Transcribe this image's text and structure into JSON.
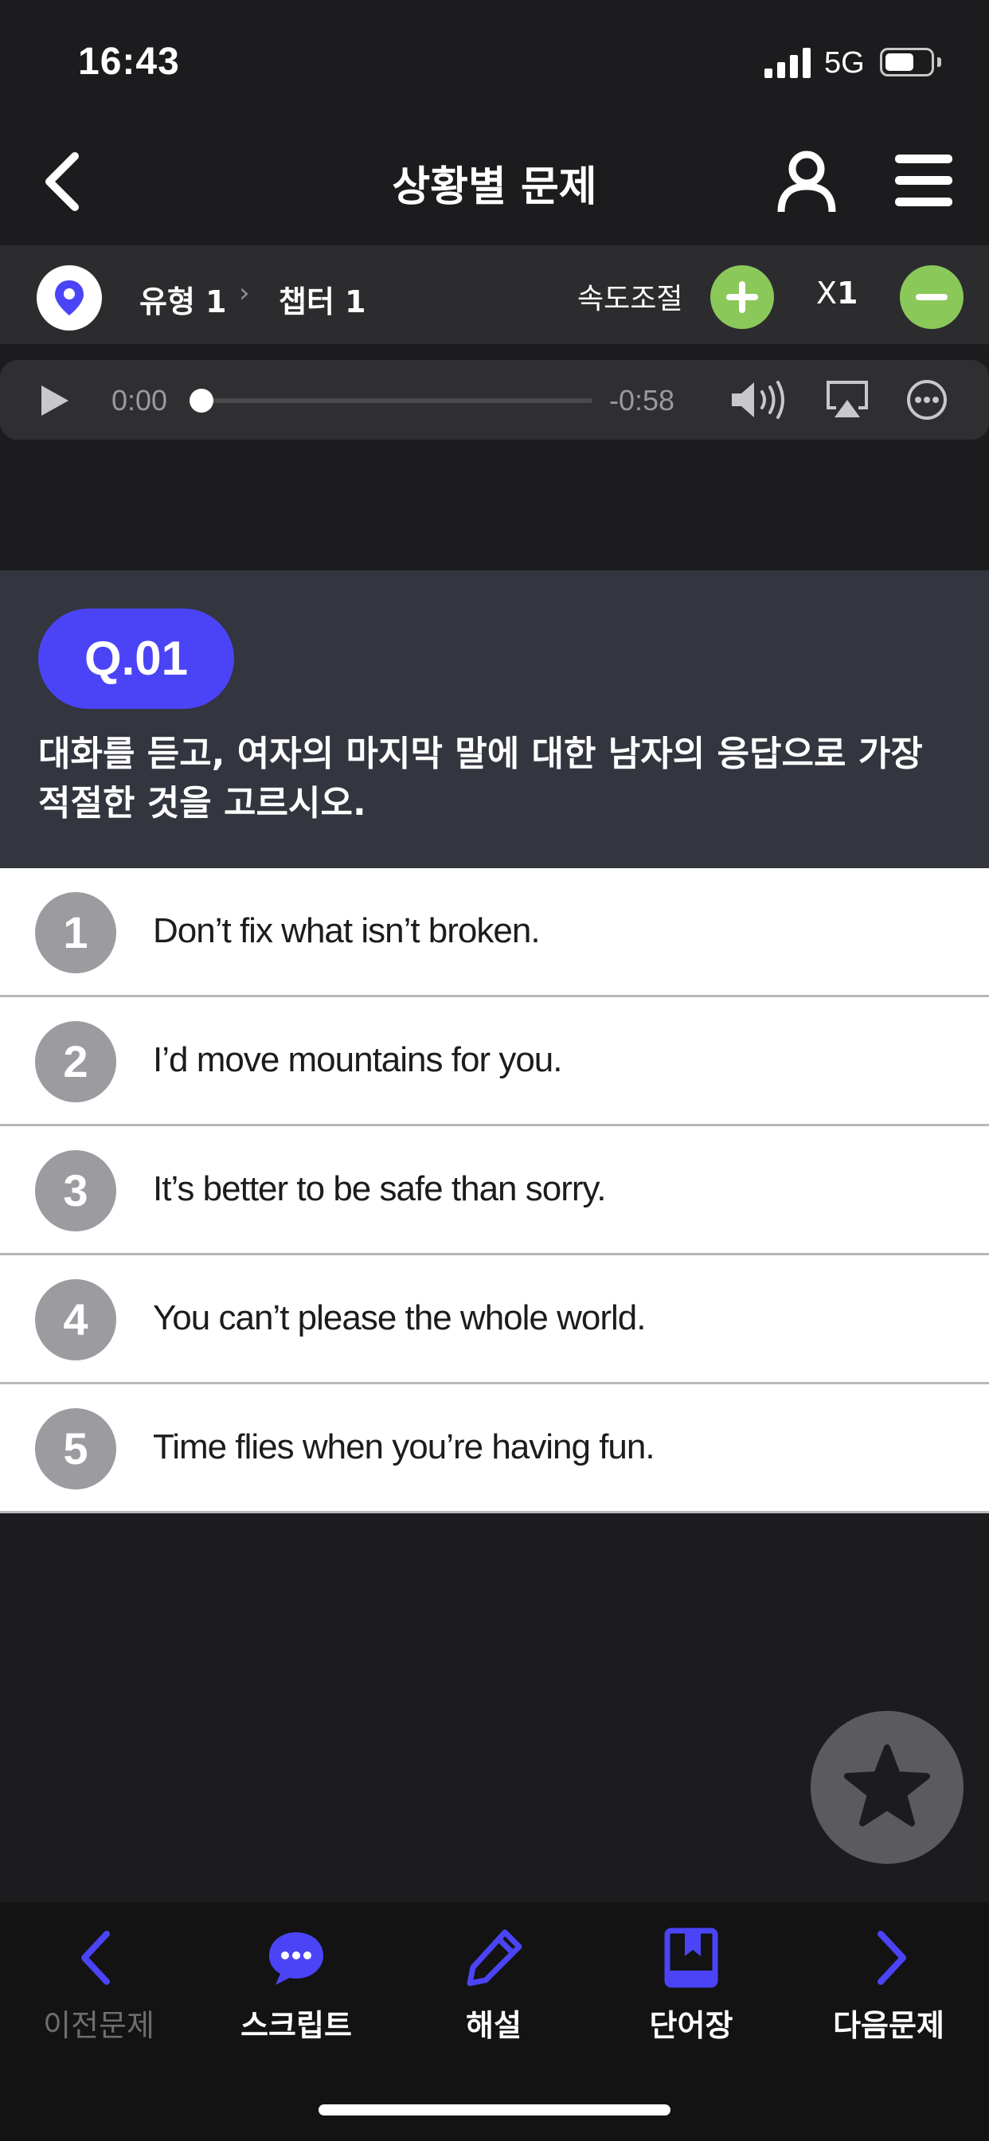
{
  "status_bar": {
    "time": "16:43",
    "network": "5G",
    "battery_level": 0.65
  },
  "header": {
    "title": "상황별 문제"
  },
  "nav": {
    "type": "유형 1",
    "separator": "›",
    "chapter": "챕터 1",
    "speed_label": "속도조절",
    "speed_prefix": "X",
    "speed_value": "1"
  },
  "player": {
    "elapsed": "0:00",
    "remaining": "-0:58",
    "progress": 0.0
  },
  "question": {
    "badge": "Q.01",
    "text": "대화를 듣고, 여자의 마지막 말에 대한 남자의 응답으로 가장 적절한 것을 고르시오."
  },
  "options": [
    {
      "num": "1",
      "text": "Don’t fix what isn’t broken."
    },
    {
      "num": "2",
      "text": "I’d move mountains for you."
    },
    {
      "num": "3",
      "text": "It’s better to be safe than sorry."
    },
    {
      "num": "4",
      "text": "You can’t please the whole world."
    },
    {
      "num": "5",
      "text": "Time flies when you’re having fun."
    }
  ],
  "tabbar": {
    "prev": "이전문제",
    "script": "스크립트",
    "explanation": "해설",
    "vocab": "단어장",
    "next": "다음문제"
  },
  "colors": {
    "accent": "#4b44f6",
    "green": "#8bc85a",
    "panel": "#33353f"
  }
}
